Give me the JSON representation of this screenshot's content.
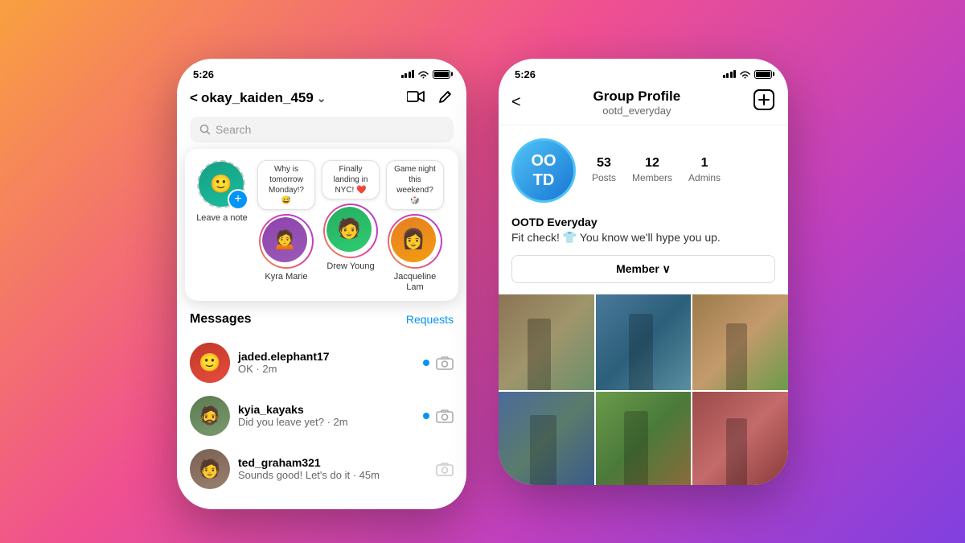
{
  "background": {
    "gradient": "linear-gradient(135deg, #f9a040, #f05090, #c040c0, #8040e0)"
  },
  "phone_left": {
    "status_bar": {
      "time": "5:26"
    },
    "nav": {
      "back_label": "<",
      "title": "okay_kaiden_459",
      "chevron": "∨",
      "video_icon": "□",
      "edit_icon": "✏"
    },
    "search": {
      "placeholder": "Search"
    },
    "stories": [
      {
        "id": "leave-note",
        "name": "Leave a note",
        "type": "add",
        "bubble": null
      },
      {
        "id": "kyra-marie",
        "name": "Kyra Marie",
        "type": "story",
        "bubble": "Why is tomorrow Monday!? 😅"
      },
      {
        "id": "drew-young",
        "name": "Drew Young",
        "type": "story",
        "bubble": "Finally landing in NYC! ❤️",
        "online": false
      },
      {
        "id": "jacqueline-lam",
        "name": "Jacqueline Lam",
        "type": "story",
        "bubble": "Game night this weekend? 🎲",
        "online": true
      }
    ],
    "messages_header": {
      "title": "Messages",
      "requests": "Requests"
    },
    "messages": [
      {
        "username": "jaded.elephant17",
        "preview": "OK · 2m",
        "unread": true,
        "face_color": "face-red"
      },
      {
        "username": "kyia_kayaks",
        "preview": "Did you leave yet? · 2m",
        "unread": true,
        "face_color": "face-blue"
      },
      {
        "username": "ted_graham321",
        "preview": "Sounds good! Let's do it · 45m",
        "unread": false,
        "face_color": "face-orange"
      }
    ]
  },
  "phone_right": {
    "status_bar": {
      "time": "5:26"
    },
    "nav": {
      "back_label": "<",
      "title": "Group Profile",
      "subtitle": "ootd_everyday",
      "add_icon": "⊕"
    },
    "group": {
      "avatar_text": "OO\nTD",
      "stats": [
        {
          "number": "53",
          "label": "Posts"
        },
        {
          "number": "12",
          "label": "Members"
        },
        {
          "number": "1",
          "label": "Admins"
        }
      ],
      "name": "OOTD Everyday",
      "description": "Fit check! 👕\nYou know we'll hype you up.",
      "member_button": "Member ∨"
    },
    "photos": [
      {
        "id": "photo-1",
        "css_class": "photo-1"
      },
      {
        "id": "photo-2",
        "css_class": "photo-2"
      },
      {
        "id": "photo-3",
        "css_class": "photo-3"
      },
      {
        "id": "photo-4",
        "css_class": "photo-4"
      },
      {
        "id": "photo-5",
        "css_class": "photo-5"
      },
      {
        "id": "photo-6",
        "css_class": "photo-6"
      }
    ]
  }
}
